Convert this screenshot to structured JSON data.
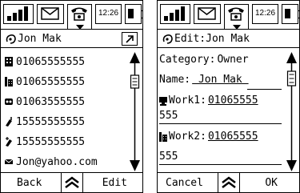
{
  "status_bar": {
    "time": "12:26",
    "icons": [
      "signal-icon",
      "mail-icon",
      "phone-icon",
      "battery-icon"
    ]
  },
  "contact_view": {
    "title": "Jon Mak",
    "rows": [
      {
        "icon": "home-phone-icon",
        "value": "01065555555"
      },
      {
        "icon": "work-phone-icon",
        "value": "01065555555"
      },
      {
        "icon": "fax-icon",
        "value": "01063555555"
      },
      {
        "icon": "mobile-phone-icon",
        "value": "15555555555"
      },
      {
        "icon": "mobile-alt-icon",
        "value": "15555555555"
      },
      {
        "icon": "email-icon",
        "value": "Jon@yahoo.com"
      }
    ],
    "softkeys": {
      "left": "Back",
      "right": "Edit"
    }
  },
  "contact_edit": {
    "title": "Edit:Jon Mak",
    "category_label": "Category:",
    "category_value": "Owner",
    "name_label": "Name:",
    "name_value": " Jon Mak ",
    "work1_label": "Work1:",
    "work1_value": "01065555",
    "work1_cont": "555",
    "work2_label": "Work2:",
    "work2_value": "01065555",
    "work2_cont": "555",
    "softkeys": {
      "left": "Cancel",
      "right": "OK"
    }
  }
}
